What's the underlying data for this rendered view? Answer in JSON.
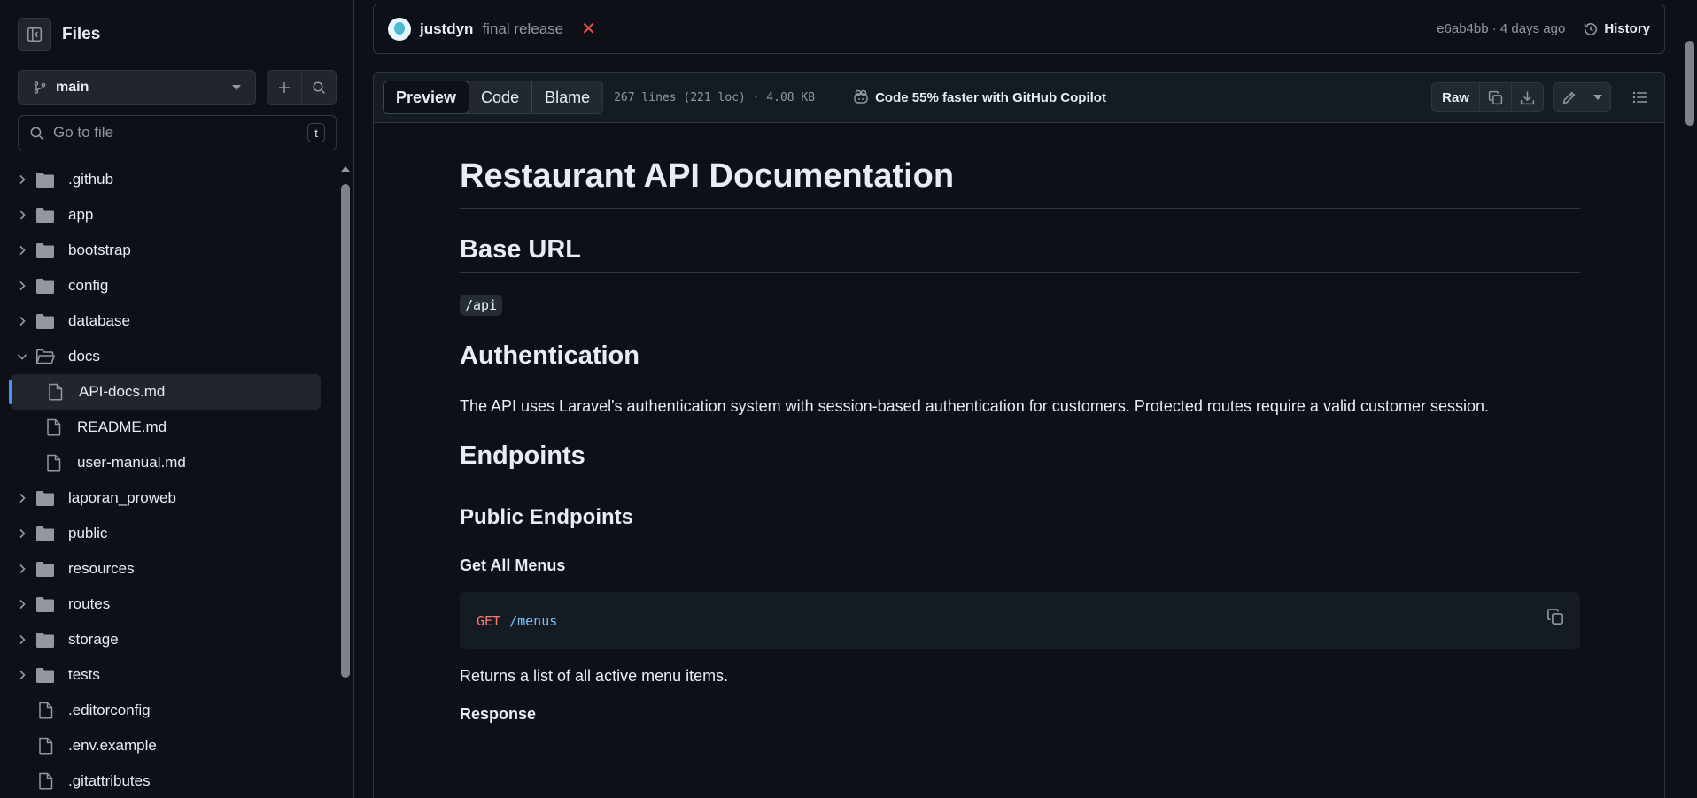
{
  "sidebar": {
    "title": "Files",
    "branch": "main",
    "search_placeholder": "Go to file",
    "search_shortcut": "t",
    "tree": [
      {
        "label": ".github",
        "type": "folder",
        "expanded": false
      },
      {
        "label": "app",
        "type": "folder",
        "expanded": false
      },
      {
        "label": "bootstrap",
        "type": "folder",
        "expanded": false
      },
      {
        "label": "config",
        "type": "folder",
        "expanded": false
      },
      {
        "label": "database",
        "type": "folder",
        "expanded": false
      },
      {
        "label": "docs",
        "type": "folder",
        "expanded": true
      },
      {
        "label": "API-docs.md",
        "type": "file",
        "child": true,
        "selected": true
      },
      {
        "label": "README.md",
        "type": "file",
        "child": true
      },
      {
        "label": "user-manual.md",
        "type": "file",
        "child": true
      },
      {
        "label": "laporan_proweb",
        "type": "folder",
        "expanded": false
      },
      {
        "label": "public",
        "type": "folder",
        "expanded": false
      },
      {
        "label": "resources",
        "type": "folder",
        "expanded": false
      },
      {
        "label": "routes",
        "type": "folder",
        "expanded": false
      },
      {
        "label": "storage",
        "type": "folder",
        "expanded": false
      },
      {
        "label": "tests",
        "type": "folder",
        "expanded": false
      },
      {
        "label": ".editorconfig",
        "type": "file"
      },
      {
        "label": ".env.example",
        "type": "file"
      },
      {
        "label": ".gitattributes",
        "type": "file"
      }
    ]
  },
  "commit": {
    "author": "justdyn",
    "message": "final release",
    "status_mark": "✕",
    "meta": "e6ab4bb · 4 days ago",
    "history_label": "History"
  },
  "file_header": {
    "tabs": [
      "Preview",
      "Code",
      "Blame"
    ],
    "active_tab": "Preview",
    "stats": "267 lines (221 loc) · 4.08 KB",
    "copilot": "Code 55% faster with GitHub Copilot",
    "raw_label": "Raw"
  },
  "doc": {
    "title": "Restaurant API Documentation",
    "base_url_heading": "Base URL",
    "base_url_code": "/api",
    "auth_heading": "Authentication",
    "auth_text": "The API uses Laravel's authentication system with session-based authentication for customers. Protected routes require a valid customer session.",
    "endpoints_heading": "Endpoints",
    "public_heading": "Public Endpoints",
    "menus_heading": "Get All Menus",
    "menus_method": "GET",
    "menus_path": "/menus",
    "menus_desc": "Returns a list of all active menu items.",
    "response_heading": "Response"
  },
  "colors": {
    "background": "#0d1117",
    "border": "#30363d",
    "accent": "#4493f8",
    "danger": "#f85149",
    "code_keyword": "#ff7b72",
    "code_path": "#79c0ff"
  }
}
